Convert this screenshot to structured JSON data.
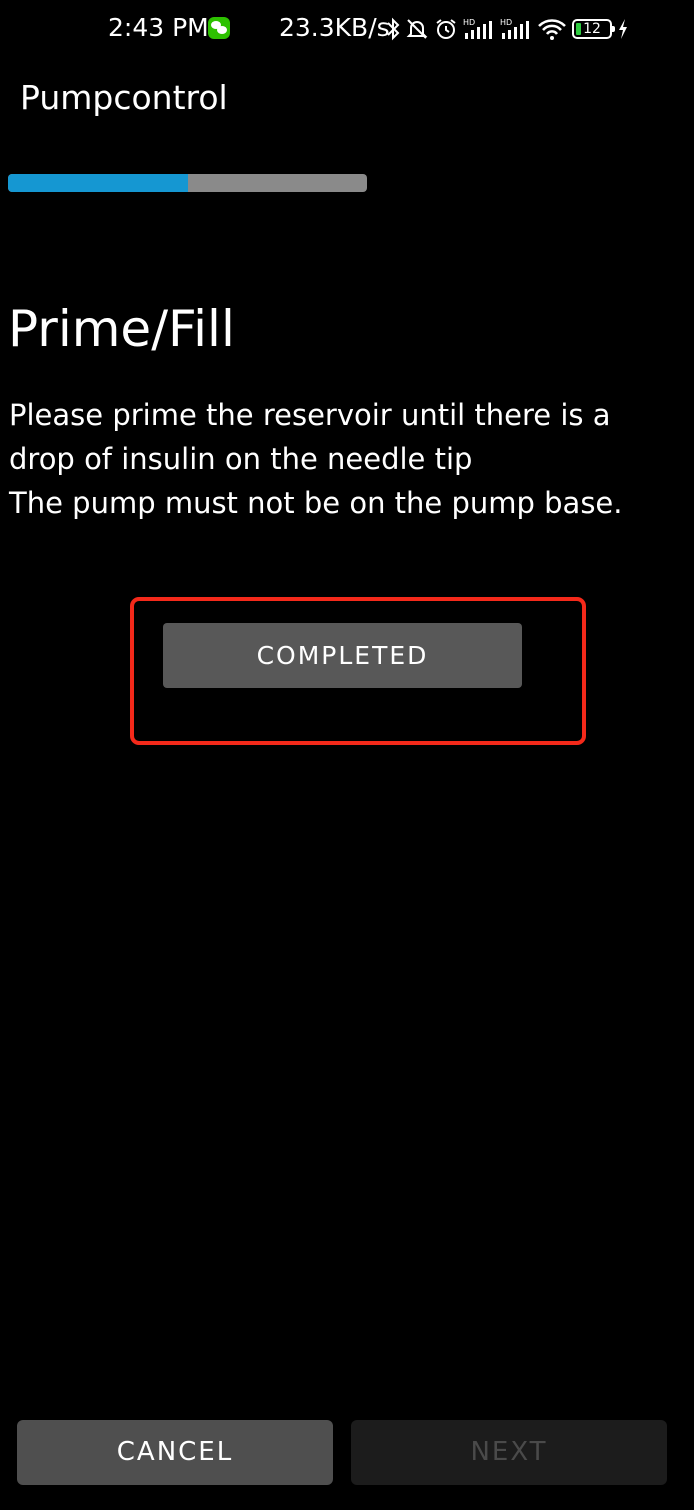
{
  "status_bar": {
    "time": "2:43 PM",
    "network_speed": "23.3KB/s",
    "battery_level": "12",
    "icons": [
      "wechat-icon",
      "bluetooth-icon",
      "mute-icon",
      "alarm-icon",
      "hd-signal-icon",
      "hd-signal-icon",
      "wifi-icon",
      "battery-icon",
      "charging-icon"
    ]
  },
  "app_bar": {
    "title": "Pumpcontrol"
  },
  "progress": {
    "fraction": 0.5
  },
  "step": {
    "title": "Prime/Fill",
    "lines": [
      "Please prime the reservoir until there is a",
      "drop of insulin on the needle tip",
      "The pump must not be on the pump base."
    ]
  },
  "actions": {
    "completed_label": "COMPLETED",
    "cancel_label": "CANCEL",
    "next_label": "NEXT"
  },
  "colors": {
    "background": "#000000",
    "progress_fill": "#1597d2",
    "progress_track": "#8a8a8a",
    "highlight": "#f4291a",
    "button": "#585858",
    "button_disabled": "#1c1c1c"
  }
}
